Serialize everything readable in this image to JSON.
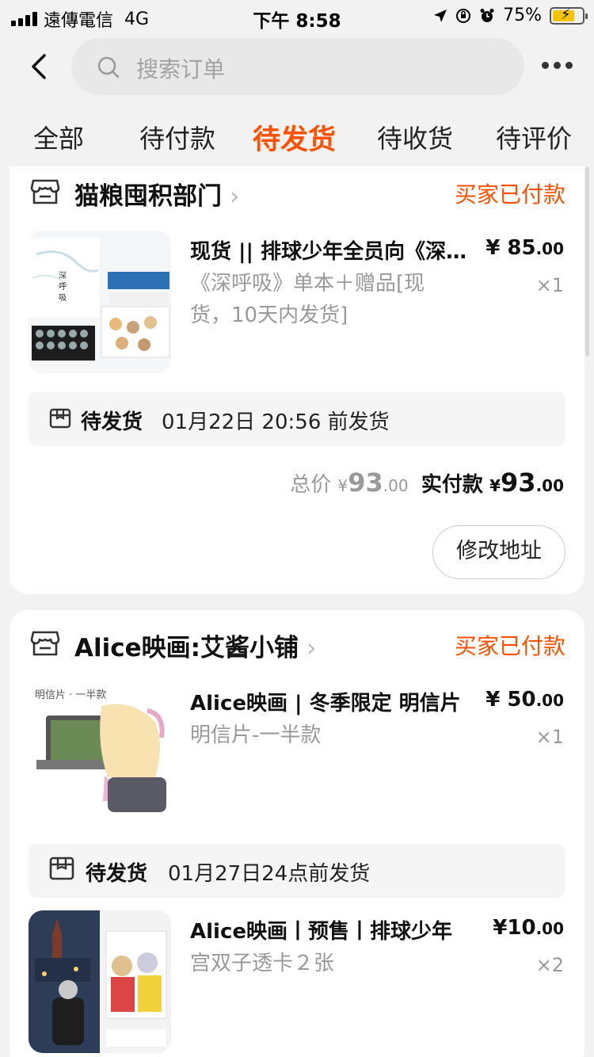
{
  "status_bar": {
    "carrier": "遠傳電信",
    "network": "4G",
    "time": "下午 8:58",
    "battery_percent": "75%"
  },
  "search": {
    "placeholder": "搜索订单"
  },
  "tabs": [
    {
      "label": "全部",
      "active": false
    },
    {
      "label": "待付款",
      "active": false
    },
    {
      "label": "待发货",
      "active": true
    },
    {
      "label": "待收货",
      "active": false
    },
    {
      "label": "待评价",
      "active": false
    }
  ],
  "colors": {
    "accent": "#ff5000"
  },
  "orders": [
    {
      "shop": "猫粮囤积部门",
      "status": "买家已付款",
      "items": [
        {
          "title": "现货 || 排球少年全员向《深呼吸》",
          "price_int": "85",
          "price_dec": ".00",
          "spec": "《深呼吸》单本＋赠品[现货，10天内发货]",
          "qty": "×1"
        }
      ],
      "ship_label": "待发货",
      "ship_text": "01月22日 20:56 前发货",
      "total_label": "总价",
      "total_int": "93",
      "total_dec": ".00",
      "paid_label": "实付款",
      "paid_int": "93",
      "paid_dec": ".00",
      "action": "修改地址"
    },
    {
      "shop": "Alice映画:艾酱小铺",
      "status": "买家已付款",
      "items": [
        {
          "title": "Alice映画 | 冬季限定 明信片",
          "price_int": "50",
          "price_dec": ".00",
          "spec": "明信片-一半款",
          "qty": "×1",
          "ship_label": "待发货",
          "ship_text": "01月27日24点前发货"
        },
        {
          "title": "Alice映画丨预售丨排球少年",
          "price_int": "10",
          "price_dec": ".00",
          "spec": "宫双子透卡２张",
          "qty": "×2"
        }
      ]
    }
  ],
  "thumb_text": {
    "postcard_caption": "明信片 · 一半款"
  },
  "currency": "¥"
}
